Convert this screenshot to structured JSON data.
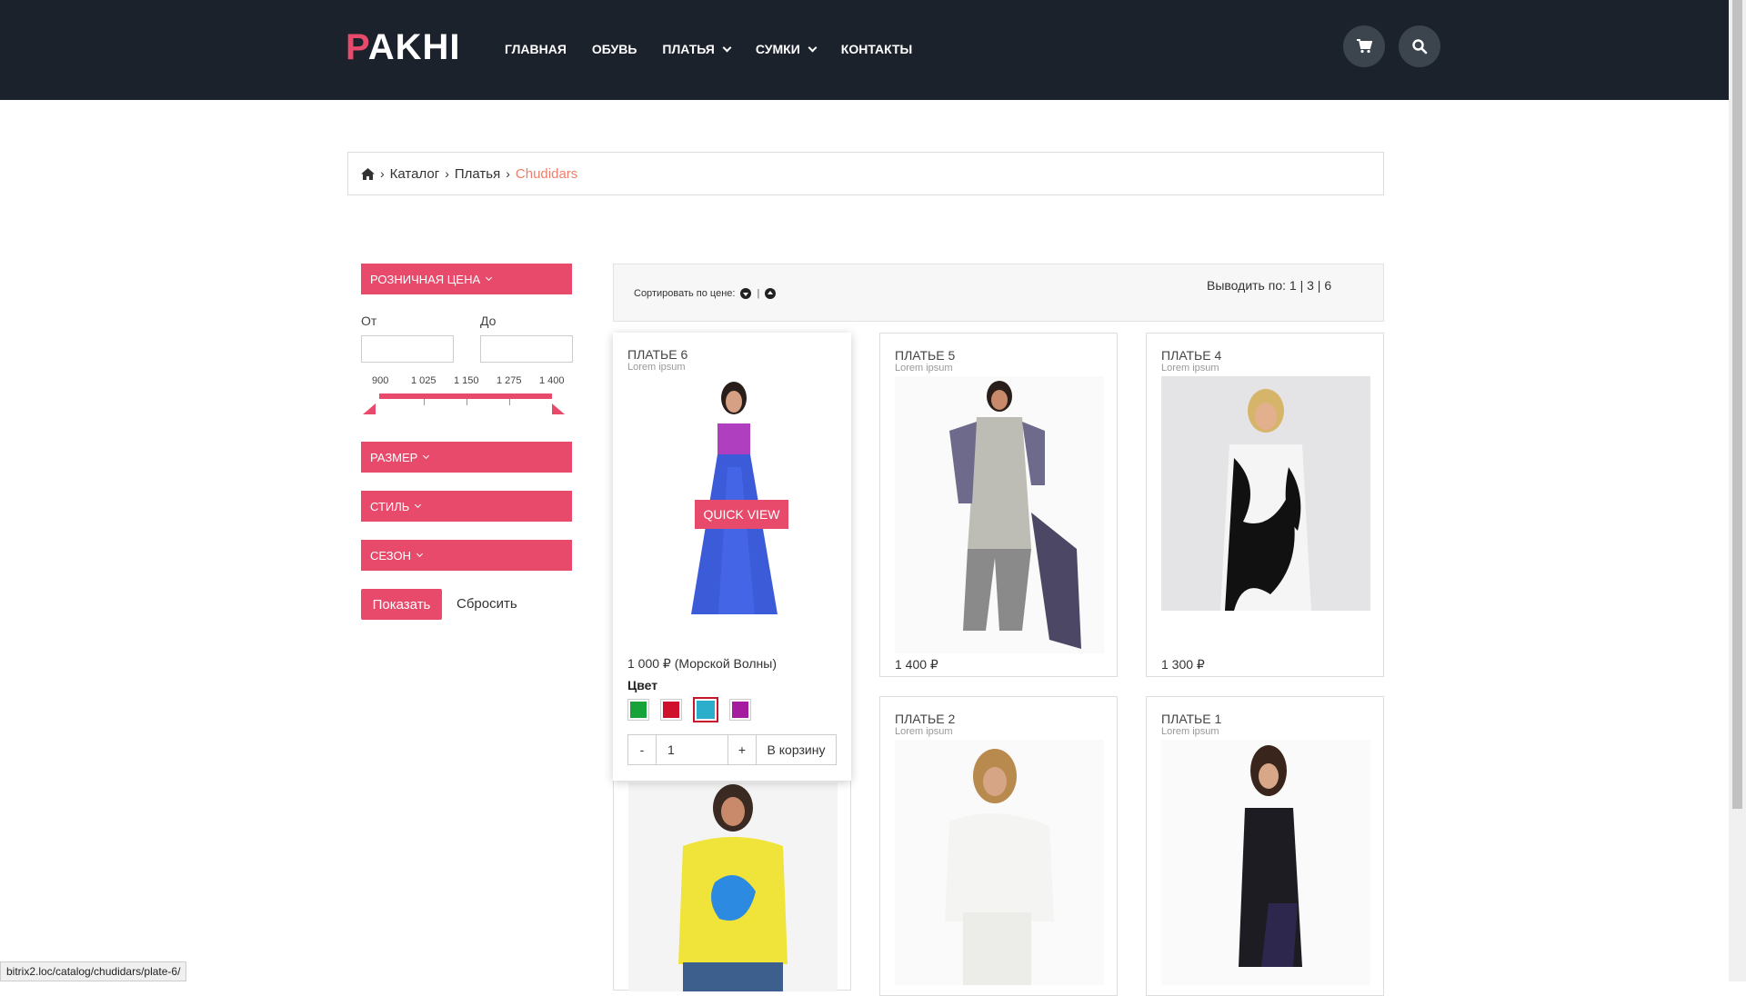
{
  "header": {
    "logo_first": "P",
    "logo_rest": "AKHI",
    "nav": [
      {
        "label": "ГЛАВНАЯ",
        "dropdown": false
      },
      {
        "label": "ОБУВЬ",
        "dropdown": false
      },
      {
        "label": "ПЛАТЬЯ",
        "dropdown": true
      },
      {
        "label": "СУМКИ",
        "dropdown": true
      },
      {
        "label": "КОНТАКТЫ",
        "dropdown": false
      }
    ],
    "icons": {
      "cart": "cart-icon",
      "search": "search-icon"
    }
  },
  "breadcrumb": {
    "home_icon": "home-icon",
    "items": [
      "Каталог",
      "Платья"
    ],
    "current": "Chudidars"
  },
  "filters": {
    "price_head": "РОЗНИЧНАЯ ЦЕНА",
    "from_label": "От",
    "to_label": "До",
    "from_value": "",
    "to_value": "",
    "slider_labels": [
      "900",
      "1 025",
      "1 150",
      "1 275",
      "1 400"
    ],
    "size_head": "РАЗМЕР",
    "style_head": "СТИЛЬ",
    "season_head": "СЕЗОН",
    "show_button": "Показать",
    "reset_link": "Сбросить"
  },
  "sortbar": {
    "sort_label": "Сортировать по цене:",
    "per_page_label": "Выводить по:",
    "per_page_options": [
      "1",
      "3",
      "6"
    ]
  },
  "products": [
    {
      "title": "ПЛАТЬЕ 6",
      "subtitle": "Lorem ipsum",
      "price": "1 000 ₽ (Морской Волны)"
    },
    {
      "title": "ПЛАТЬЕ 5",
      "subtitle": "Lorem ipsum",
      "price": "1 400 ₽"
    },
    {
      "title": "ПЛАТЬЕ 4",
      "subtitle": "Lorem ipsum",
      "price": "1 300 ₽"
    },
    {
      "title": "ПЛАТЬЕ 2",
      "subtitle": "Lorem ipsum",
      "price": ""
    },
    {
      "title": "ПЛАТЬЕ 1",
      "subtitle": "Lorem ipsum",
      "price": ""
    }
  ],
  "active_card": {
    "quick_view": "QUICK VIEW",
    "color_label": "Цвет",
    "swatches": [
      "#17a33a",
      "#d0112b",
      "#2aaecb",
      "#a51d9f"
    ],
    "selected_swatch": 2,
    "qty_minus": "-",
    "qty_value": "1",
    "qty_plus": "+",
    "to_cart": "В корзину"
  },
  "status_url": "bitrix2.loc/catalog/chudidars/plate-6/",
  "colors": {
    "accent": "#e84a6b",
    "header_bg": "#1b222b",
    "breadcrumb_current": "#ef7d6a"
  }
}
